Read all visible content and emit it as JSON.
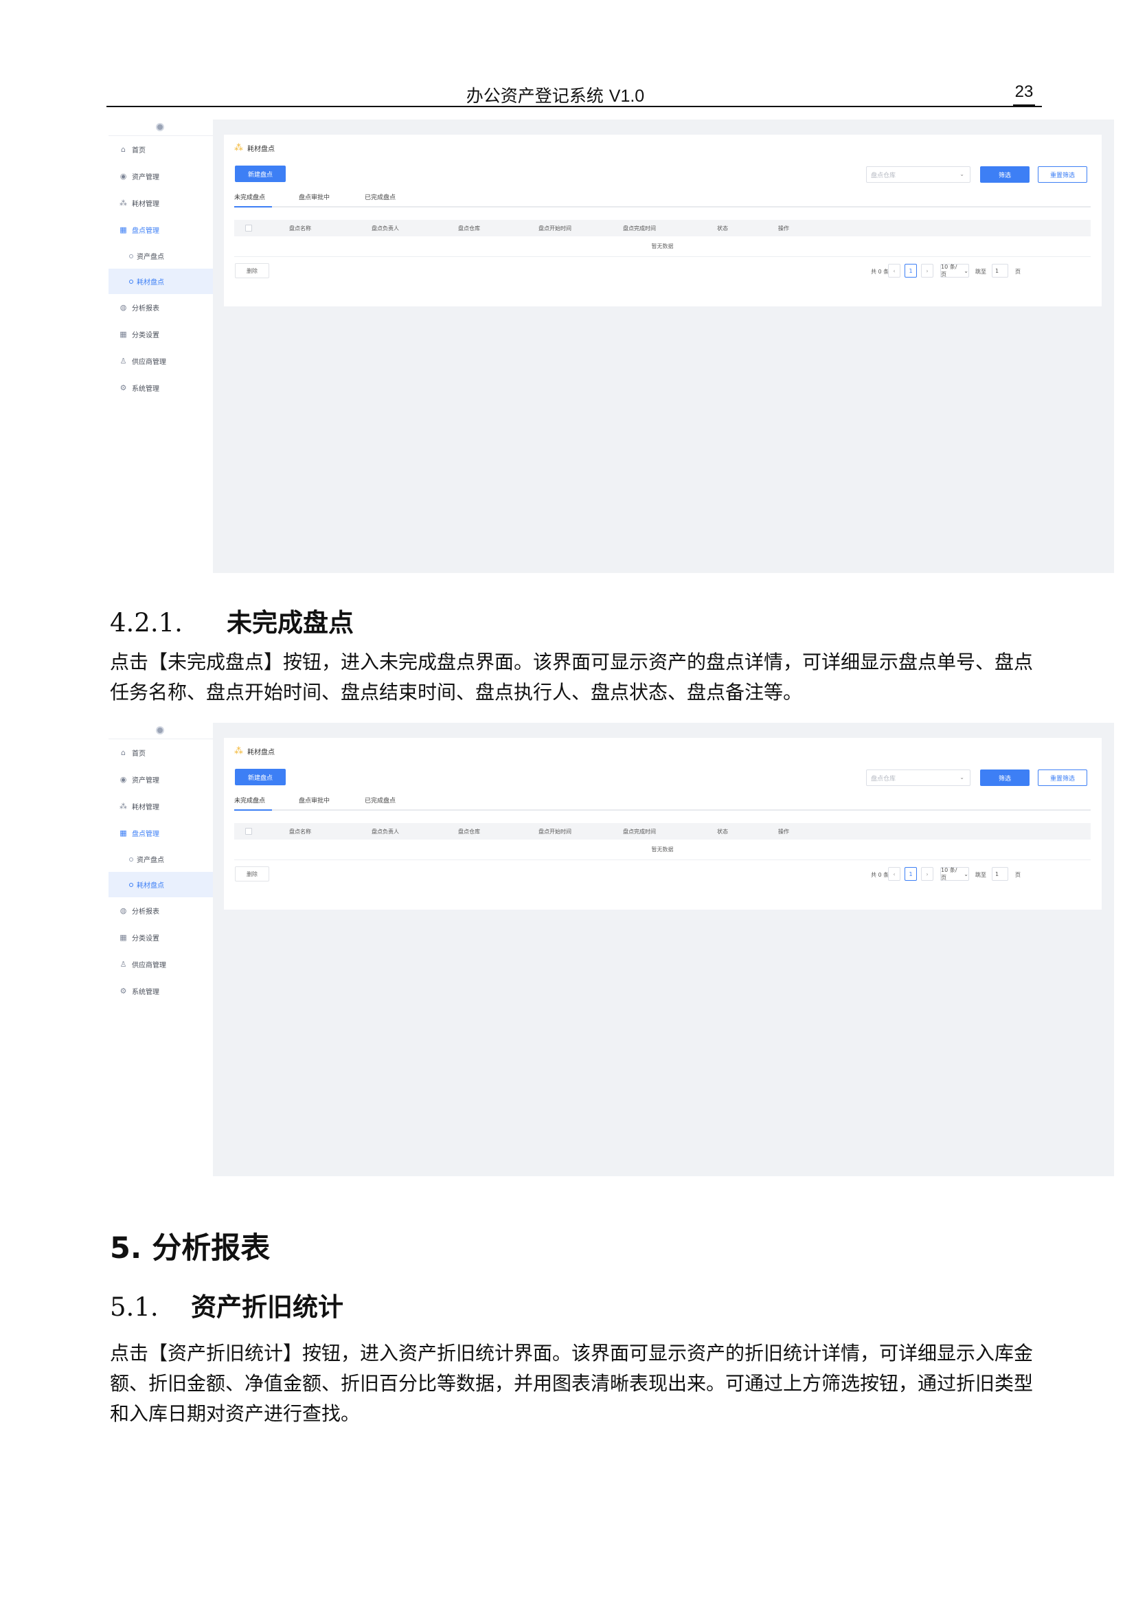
{
  "header": {
    "title": "办公资产登记系统",
    "version": "V1.0",
    "page_number": "23"
  },
  "app": {
    "sidebar": {
      "items": [
        {
          "label": "首页",
          "icon": "home-icon",
          "glyph": "⌂"
        },
        {
          "label": "资产管理",
          "icon": "asset-icon",
          "glyph": "◉"
        },
        {
          "label": "耗材管理",
          "icon": "consumable-icon",
          "glyph": "⁂"
        },
        {
          "label": "盘点管理",
          "icon": "calendar-icon",
          "glyph": "▦"
        }
      ],
      "subitems": [
        {
          "label": "资产盘点"
        },
        {
          "label": "耗材盘点"
        }
      ],
      "items_after": [
        {
          "label": "分析报表",
          "icon": "report-icon",
          "glyph": "◍"
        },
        {
          "label": "分类设置",
          "icon": "grid-icon",
          "glyph": "▦"
        },
        {
          "label": "供应商管理",
          "icon": "user-icon",
          "glyph": "♙"
        },
        {
          "label": "系统管理",
          "icon": "gear-icon",
          "glyph": "⚙"
        }
      ]
    },
    "card_title": "耗材盘点",
    "new_button": "新建盘点",
    "select_placeholder": "盘点仓库",
    "filter_button": "筛选",
    "reset_button": "重置筛选",
    "tabs": [
      "未完成盘点",
      "盘点审批中",
      "已完成盘点"
    ],
    "columns": [
      "盘点名称",
      "盘点负责人",
      "盘点仓库",
      "盘点开始时间",
      "盘点完成时间",
      "状态",
      "操作"
    ],
    "empty_text": "暂无数据",
    "delete_button": "删除",
    "pagination": {
      "total": "共 0 条",
      "current": "1",
      "page_size": "10 条/页",
      "jump_label": "跳至",
      "jump_value": "1",
      "unit": "页"
    },
    "colors": {
      "primary": "#3d7ff5",
      "content_bg": "#f0f2f5",
      "title_icon": "#f2b632"
    }
  },
  "section_421": {
    "number": "4.2.1.",
    "title": "未完成盘点",
    "paragraph": "点击【未完成盘点】按钮，进入未完成盘点界面。该界面可显示资产的盘点详情，可详细显示盘点单号、盘点任务名称、盘点开始时间、盘点结束时间、盘点执行人、盘点状态、盘点备注等。"
  },
  "section_5": {
    "number": "5.",
    "title": "分析报表"
  },
  "section_51": {
    "number": "5.1.",
    "title": "资产折旧统计",
    "paragraph": "点击【资产折旧统计】按钮，进入资产折旧统计界面。该界面可显示资产的折旧统计详情，可详细显示入库金额、折旧金额、净值金额、折旧百分比等数据，并用图表清晰表现出来。可通过上方筛选按钮，通过折旧类型和入库日期对资产进行查找。"
  }
}
